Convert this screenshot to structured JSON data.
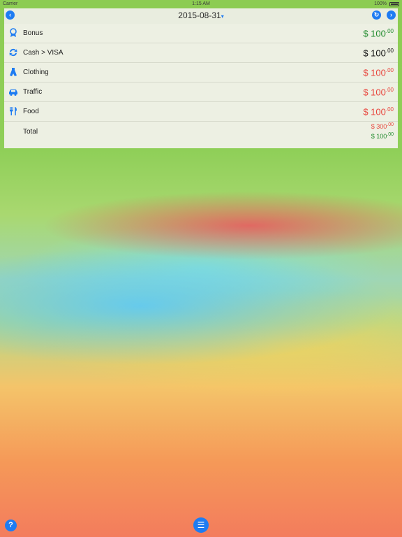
{
  "status_bar": {
    "carrier": "Carrier",
    "time": "1:15 AM",
    "battery": "100%"
  },
  "nav": {
    "date": "2015-08-31",
    "dropdown": "▾"
  },
  "rows": [
    {
      "label": "Bonus",
      "amount_main": "$ 100",
      "amount_cents": ".00",
      "color": "#1f8a2c",
      "icon": "award-icon"
    },
    {
      "label": "Cash > VISA",
      "amount_main": "$ 100",
      "amount_cents": ".00",
      "color": "#111111",
      "icon": "transfer-icon"
    },
    {
      "label": "Clothing",
      "amount_main": "$ 100",
      "amount_cents": ".00",
      "color": "#e8443c",
      "icon": "clothing-icon"
    },
    {
      "label": "Traffic",
      "amount_main": "$ 100",
      "amount_cents": ".00",
      "color": "#e8443c",
      "icon": "car-icon"
    },
    {
      "label": "Food",
      "amount_main": "$ 100",
      "amount_cents": ".00",
      "color": "#e8443c",
      "icon": "fork-knife-icon"
    }
  ],
  "total": {
    "label": "Total",
    "expense_main": "$ 300",
    "expense_cents": ".00",
    "income_main": "$ 100",
    "income_cents": ".00"
  },
  "buttons": {
    "help": "?",
    "list": "☰"
  },
  "colors": {
    "accent": "#1e7cf2",
    "income": "#1f8a2c",
    "expense": "#e8443c"
  }
}
